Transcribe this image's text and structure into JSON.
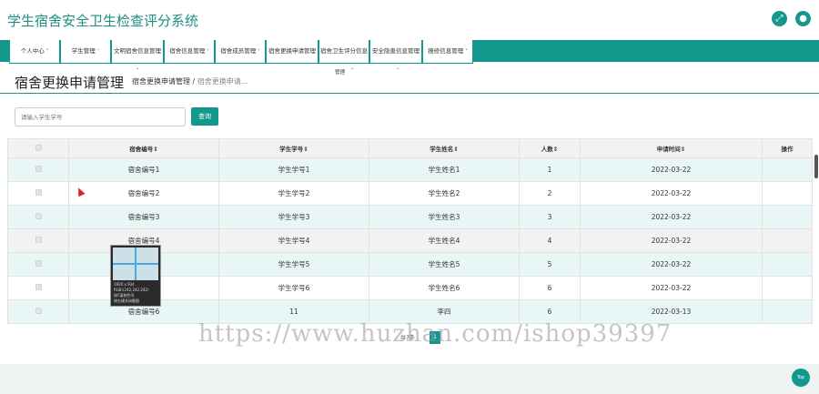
{
  "app": {
    "title": "学生宿舍安全卫生检查评分系统",
    "icons": [
      "expand-icon",
      "user-icon"
    ]
  },
  "nav": {
    "items": [
      {
        "label": "个人中心",
        "caret": "˅"
      },
      {
        "label": "学生管理",
        "caret": "˅"
      },
      {
        "label": "文明宿舍信息管理",
        "caret": ""
      },
      {
        "label": "宿舍信息管理",
        "caret": "˅"
      },
      {
        "label": "宿舍成员管理",
        "caret": "˅"
      },
      {
        "label": "宿舍更换申请管理",
        "caret": ""
      },
      {
        "label": "宿舍卫生评分信息",
        "caret": ""
      },
      {
        "label": "安全隐患信息管理",
        "caret": ""
      },
      {
        "label": "报修信息管理",
        "caret": "˅"
      }
    ],
    "subitems": [
      "˅",
      "管理",
      "˅",
      "˅"
    ]
  },
  "page": {
    "title": "宿舍更换申请管理",
    "breadcrumb_current": "宿舍更换申请管理",
    "breadcrumb_sep": "/",
    "breadcrumb_trail": "宿舍更换申请..."
  },
  "search": {
    "placeholder": "请输入学生学号",
    "button_label": "查询"
  },
  "table": {
    "headers": [
      "宿舍编号",
      "学生学号",
      "学生姓名",
      "人数",
      "申请时间",
      "操作"
    ],
    "rows": [
      [
        "宿舍编号1",
        "学生学号1",
        "学生姓名1",
        "1",
        "2022-03-22",
        ""
      ],
      [
        "宿舍编号2",
        "学生学号2",
        "学生姓名2",
        "2",
        "2022-03-22",
        ""
      ],
      [
        "宿舍编号3",
        "学生学号3",
        "学生姓名3",
        "3",
        "2022-03-22",
        ""
      ],
      [
        "宿舍编号4",
        "学生学号4",
        "学生姓名4",
        "4",
        "2022-03-22",
        ""
      ],
      [
        "",
        "学生学号5",
        "学生姓名5",
        "5",
        "2022-03-22",
        ""
      ],
      [
        "",
        "学生学号6",
        "学生姓名6",
        "6",
        "2022-03-22",
        ""
      ],
      [
        "宿舍编号6",
        "11",
        "李四",
        "6",
        "2022-03-13",
        ""
      ]
    ]
  },
  "pager": {
    "total": "共7条",
    "page": "1"
  },
  "overlay": {
    "size_line": "1920 x 934",
    "rgb_line": "RGB:(242,242,242)",
    "copy_line": "按C复制色号",
    "close_line": "按右键关闭截图"
  },
  "watermark": "https://www.huzhan.com/ishop39397",
  "top_button": "Top",
  "colors": {
    "accent": "#14978c",
    "alt_row": "#e9f6f6"
  }
}
